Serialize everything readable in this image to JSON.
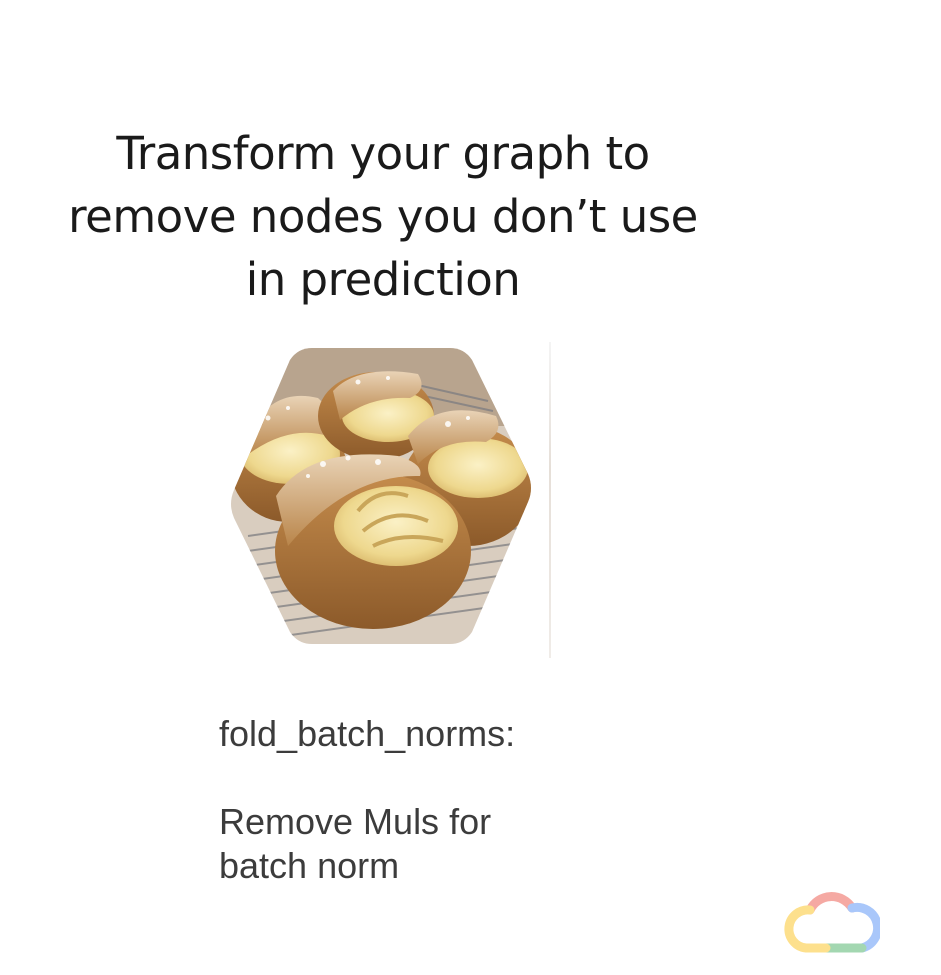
{
  "slide": {
    "title": "Transform your graph to\nremove nodes you don’t use\nin prediction",
    "transform_name": "fold_batch_norms:",
    "description_line1": "Remove Muls for",
    "description_line2": "batch norm"
  },
  "icons": {
    "photo": "cream-puffs-photo",
    "logo": "google-cloud-logo"
  },
  "colors": {
    "title_text": "#1a1a1a",
    "caption_text": "#3c3c3c",
    "background": "#ffffff",
    "logo_red": "#ea4335",
    "logo_yellow": "#fbbc04",
    "logo_green": "#34a853",
    "logo_blue": "#4285f4"
  }
}
